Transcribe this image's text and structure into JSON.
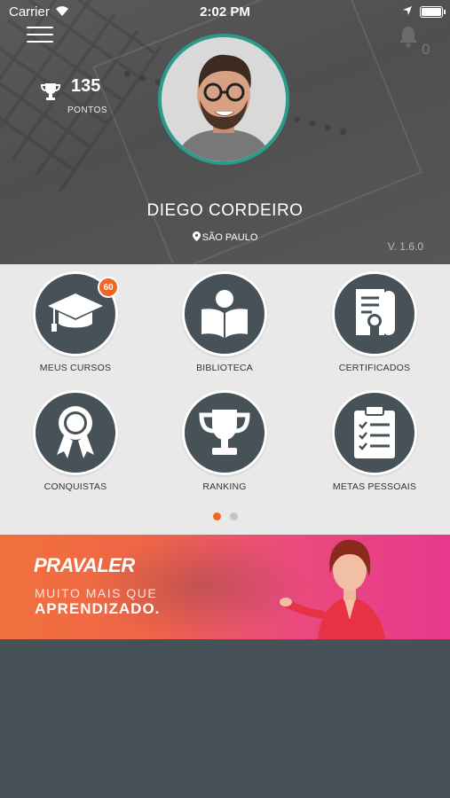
{
  "status_bar": {
    "carrier": "Carrier",
    "time": "2:02 PM"
  },
  "header": {
    "points_value": "135",
    "points_label": "PONTOS",
    "notifications_count": "0",
    "user_name": "DIEGO CORDEIRO",
    "city": "SÃO PAULO",
    "version": "V. 1.6.0"
  },
  "menu": [
    {
      "label": "MEUS CURSOS",
      "icon": "graduation-cap-icon",
      "badge": "60"
    },
    {
      "label": "BIBLIOTECA",
      "icon": "reader-book-icon"
    },
    {
      "label": "CERTIFICADOS",
      "icon": "certificate-icon"
    },
    {
      "label": "CONQUISTAS",
      "icon": "award-ribbon-icon"
    },
    {
      "label": "RANKING",
      "icon": "trophy-icon"
    },
    {
      "label": "METAS PESSOAIS",
      "icon": "clipboard-checklist-icon"
    }
  ],
  "pagination": {
    "pages": 2,
    "active": 1
  },
  "banner": {
    "brand": "PRAVALER",
    "line1": "MUITO MAIS QUE",
    "line2": "APRENDIZADO."
  },
  "colors": {
    "accent": "#f26522",
    "tile_bg": "#465158",
    "avatar_border": "#2a9c8d",
    "dot_inactive": "#c4c4c4"
  }
}
